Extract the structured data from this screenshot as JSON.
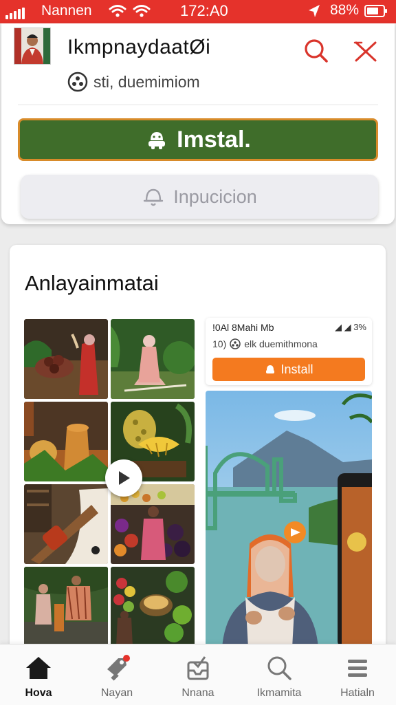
{
  "status_bar": {
    "carrier": "Nannen",
    "time": "172:A0",
    "battery": "88%"
  },
  "app": {
    "title": "IkmpnaydaatØi",
    "subtitle": "sti, duemimiom",
    "install_label": "Imstal.",
    "notify_label": "Inpucicion"
  },
  "gallery": {
    "title": "Anlayainmatai"
  },
  "preview": {
    "status_left": "!0Al 8Mahi Mb",
    "status_right": "◢ ◢ 3%",
    "sub_prefix": "10)",
    "sub_text": "elk duemithmona",
    "install_label": "Install"
  },
  "nav": {
    "items": [
      {
        "label": "Hova",
        "icon": "home-icon"
      },
      {
        "label": "Nayan",
        "icon": "tag-icon"
      },
      {
        "label": "Nnana",
        "icon": "inbox-icon"
      },
      {
        "label": "Ikmamita",
        "icon": "search-icon"
      },
      {
        "label": "Hatialn",
        "icon": "menu-icon"
      }
    ]
  },
  "colors": {
    "status_bar": "#e5322b",
    "install_green": "#3f6d2a",
    "install_border": "#d88b2a",
    "preview_install": "#f47a1f",
    "icon_red": "#d9342b"
  }
}
